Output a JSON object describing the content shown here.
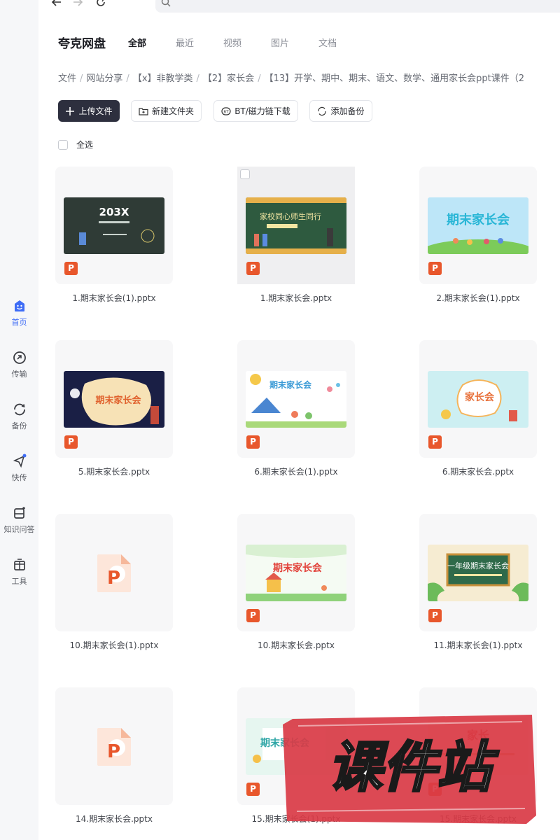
{
  "browser": {
    "back_icon": "arrow-left-icon",
    "forward_icon": "arrow-right-icon",
    "reload_icon": "reload-icon"
  },
  "sidebar": {
    "items": [
      {
        "label": "首页",
        "icon": "home-smile-icon",
        "active": true
      },
      {
        "label": "传输",
        "icon": "transfer-icon"
      },
      {
        "label": "备份",
        "icon": "backup-icon"
      },
      {
        "label": "快传",
        "icon": "quick-send-icon"
      },
      {
        "label": "知识问答",
        "icon": "knowledge-qa-icon"
      },
      {
        "label": "工具",
        "icon": "toolbox-icon"
      }
    ]
  },
  "header": {
    "brand": "夸克网盘",
    "tabs": [
      "全部",
      "最近",
      "视频",
      "图片",
      "文档"
    ]
  },
  "breadcrumb": [
    "文件",
    "网站分享",
    "【x】非教学类",
    "【2】家长会",
    "【13】开学、期中、期末、语文、数学、通用家长会ppt课件（2"
  ],
  "toolbar": {
    "upload": "上传文件",
    "new_folder": "新建文件夹",
    "bt_download": "BT/磁力链下载",
    "add_backup": "添加备份"
  },
  "select_all": "全选",
  "files": [
    {
      "name": "1.期末家长会(1).pptx",
      "thumb_text": "203X"
    },
    {
      "name": "1.期末家长会.pptx",
      "thumb_text": "家校同心师生同行"
    },
    {
      "name": "2.期末家长会(1).pptx",
      "thumb_text": "期末家长会"
    },
    {
      "name": "5.期末家长会.pptx",
      "thumb_text": "期末家长会"
    },
    {
      "name": "6.期末家长会(1).pptx",
      "thumb_text": "期末家长会"
    },
    {
      "name": "6.期末家长会.pptx",
      "thumb_text": "家长会"
    },
    {
      "name": "10.期末家长会(1).pptx",
      "thumb_text": ""
    },
    {
      "name": "10.期末家长会.pptx",
      "thumb_text": "期末家长会"
    },
    {
      "name": "11.期末家长会(1).pptx",
      "thumb_text": "一年级期末家长会"
    },
    {
      "name": "14.期末家长会.pptx",
      "thumb_text": ""
    },
    {
      "name": "15.期末家长会(1).pptx",
      "thumb_text": "期末家长会"
    },
    {
      "name": "15.期末家长会.pptx",
      "thumb_text": "家长"
    }
  ],
  "file_type_badge": "P",
  "watermark": {
    "text": "课件站",
    "color": "#d93a45"
  }
}
